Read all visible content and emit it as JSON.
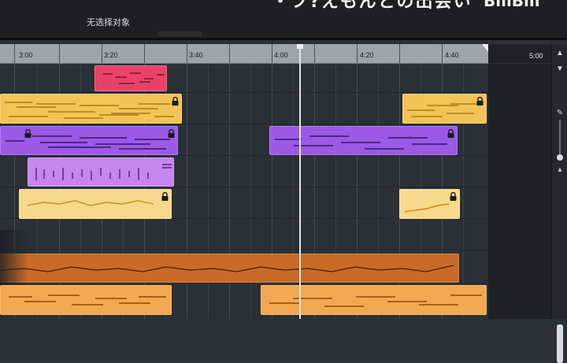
{
  "toolbar": {
    "selection_status": "无选择对象",
    "overlay_text": "・フ?えもんとの出会い",
    "logo_text": "BiliBili"
  },
  "ruler": {
    "labels": [
      "3:00",
      "3:20",
      "3:40",
      "4:00",
      "4:20",
      "4:40"
    ],
    "end_label": "5:00"
  },
  "colors": {
    "pink": "#e8426a",
    "gold": "#f2c456",
    "purple": "#9b59e6",
    "lilac": "#c785f0",
    "pale_yellow": "#f6d98a",
    "orange_brown": "#c86a28",
    "orange": "#f2a850",
    "background": "#2b3036"
  },
  "scrollbar": {
    "up_icon": "chevron-up-icon",
    "edit_icon": "pencil-icon"
  }
}
